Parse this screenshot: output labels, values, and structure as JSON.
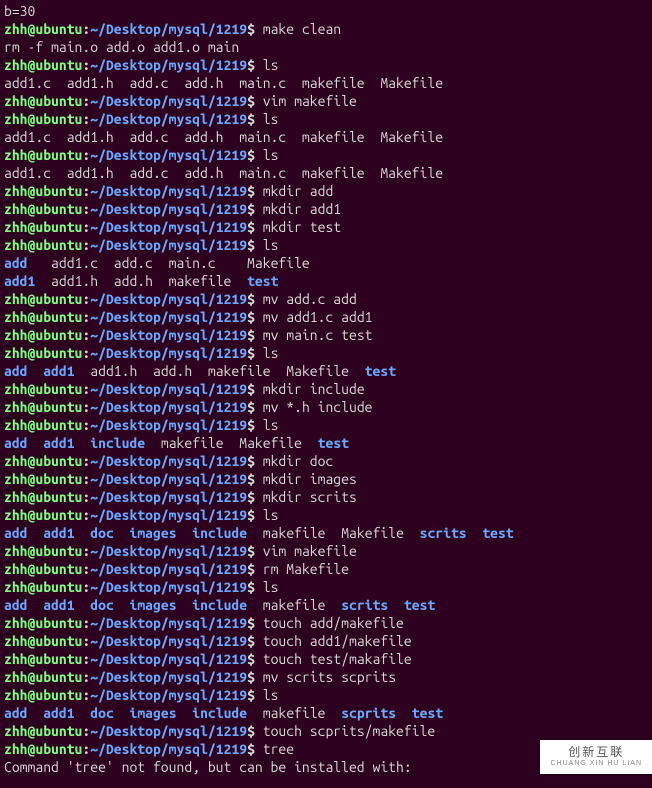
{
  "prompt": {
    "user": "zhh@ubuntu",
    "sep": ":",
    "path": "~/Desktop/mysql/1219",
    "dollar": "$"
  },
  "top": "b=30",
  "lines": [
    {
      "t": "p",
      "c": "make clean"
    },
    {
      "t": "o",
      "c": "rm -f main.o add.o add1.o main"
    },
    {
      "t": "p",
      "c": "ls"
    },
    {
      "t": "o",
      "c": "add1.c  add1.h  add.c  add.h  main.c  makefile  Makefile"
    },
    {
      "t": "p",
      "c": "vim makefile"
    },
    {
      "t": "p",
      "c": "ls"
    },
    {
      "t": "o",
      "c": "add1.c  add1.h  add.c  add.h  main.c  makefile  Makefile"
    },
    {
      "t": "p",
      "c": "ls"
    },
    {
      "t": "o",
      "c": "add1.c  add1.h  add.c  add.h  main.c  makefile  Makefile"
    },
    {
      "t": "p",
      "c": "mkdir add"
    },
    {
      "t": "p",
      "c": "mkdir add1"
    },
    {
      "t": "p",
      "c": "mkdir test"
    },
    {
      "t": "p",
      "c": "ls"
    },
    {
      "t": "ls",
      "s": [
        [
          "d",
          "add"
        ],
        [
          "o",
          "   add1.c  add.c  main.c    Makefile"
        ]
      ]
    },
    {
      "t": "ls",
      "s": [
        [
          "d",
          "add1"
        ],
        [
          "o",
          "  add1.h  add.h  makefile  "
        ],
        [
          "d",
          "test"
        ]
      ]
    },
    {
      "t": "p",
      "c": "mv add.c add"
    },
    {
      "t": "p",
      "c": "mv add1.c add1"
    },
    {
      "t": "p",
      "c": "mv main.c test"
    },
    {
      "t": "p",
      "c": "ls"
    },
    {
      "t": "ls",
      "s": [
        [
          "d",
          "add"
        ],
        [
          "o",
          "  "
        ],
        [
          "d",
          "add1"
        ],
        [
          "o",
          "  add1.h  add.h  makefile  Makefile  "
        ],
        [
          "d",
          "test"
        ]
      ]
    },
    {
      "t": "p",
      "c": "mkdir include"
    },
    {
      "t": "p",
      "c": "mv *.h include"
    },
    {
      "t": "p",
      "c": "ls"
    },
    {
      "t": "ls",
      "s": [
        [
          "d",
          "add"
        ],
        [
          "o",
          "  "
        ],
        [
          "d",
          "add1"
        ],
        [
          "o",
          "  "
        ],
        [
          "d",
          "include"
        ],
        [
          "o",
          "  makefile  Makefile  "
        ],
        [
          "d",
          "test"
        ]
      ]
    },
    {
      "t": "p",
      "c": "mkdir doc"
    },
    {
      "t": "p",
      "c": "mkdir images"
    },
    {
      "t": "p",
      "c": "mkdir scrits"
    },
    {
      "t": "p",
      "c": "ls"
    },
    {
      "t": "ls",
      "s": [
        [
          "d",
          "add"
        ],
        [
          "o",
          "  "
        ],
        [
          "d",
          "add1"
        ],
        [
          "o",
          "  "
        ],
        [
          "d",
          "doc"
        ],
        [
          "o",
          "  "
        ],
        [
          "d",
          "images"
        ],
        [
          "o",
          "  "
        ],
        [
          "d",
          "include"
        ],
        [
          "o",
          "  makefile  Makefile  "
        ],
        [
          "d",
          "scrits"
        ],
        [
          "o",
          "  "
        ],
        [
          "d",
          "test"
        ]
      ]
    },
    {
      "t": "p",
      "c": "vim makefile"
    },
    {
      "t": "p",
      "c": "rm Makefile"
    },
    {
      "t": "p",
      "c": "ls"
    },
    {
      "t": "ls",
      "s": [
        [
          "d",
          "add"
        ],
        [
          "o",
          "  "
        ],
        [
          "d",
          "add1"
        ],
        [
          "o",
          "  "
        ],
        [
          "d",
          "doc"
        ],
        [
          "o",
          "  "
        ],
        [
          "d",
          "images"
        ],
        [
          "o",
          "  "
        ],
        [
          "d",
          "include"
        ],
        [
          "o",
          "  makefile  "
        ],
        [
          "d",
          "scrits"
        ],
        [
          "o",
          "  "
        ],
        [
          "d",
          "test"
        ]
      ]
    },
    {
      "t": "p",
      "c": "touch add/makefile"
    },
    {
      "t": "p",
      "c": "touch add1/makefile"
    },
    {
      "t": "p",
      "c": "touch test/makafile"
    },
    {
      "t": "p",
      "c": "mv scrits scprits"
    },
    {
      "t": "p",
      "c": "ls"
    },
    {
      "t": "ls",
      "s": [
        [
          "d",
          "add"
        ],
        [
          "o",
          "  "
        ],
        [
          "d",
          "add1"
        ],
        [
          "o",
          "  "
        ],
        [
          "d",
          "doc"
        ],
        [
          "o",
          "  "
        ],
        [
          "d",
          "images"
        ],
        [
          "o",
          "  "
        ],
        [
          "d",
          "include"
        ],
        [
          "o",
          "  makefile  "
        ],
        [
          "d",
          "scprits"
        ],
        [
          "o",
          "  "
        ],
        [
          "d",
          "test"
        ]
      ]
    },
    {
      "t": "p",
      "c": "touch scprits/makefile"
    },
    {
      "t": "p",
      "c": "tree"
    },
    {
      "t": "o",
      "c": ""
    },
    {
      "t": "o",
      "c": "Command 'tree' not found, but can be installed with:"
    }
  ],
  "watermark": {
    "cn": "创新互联",
    "en": "CHUANG XIN HU LIAN"
  }
}
